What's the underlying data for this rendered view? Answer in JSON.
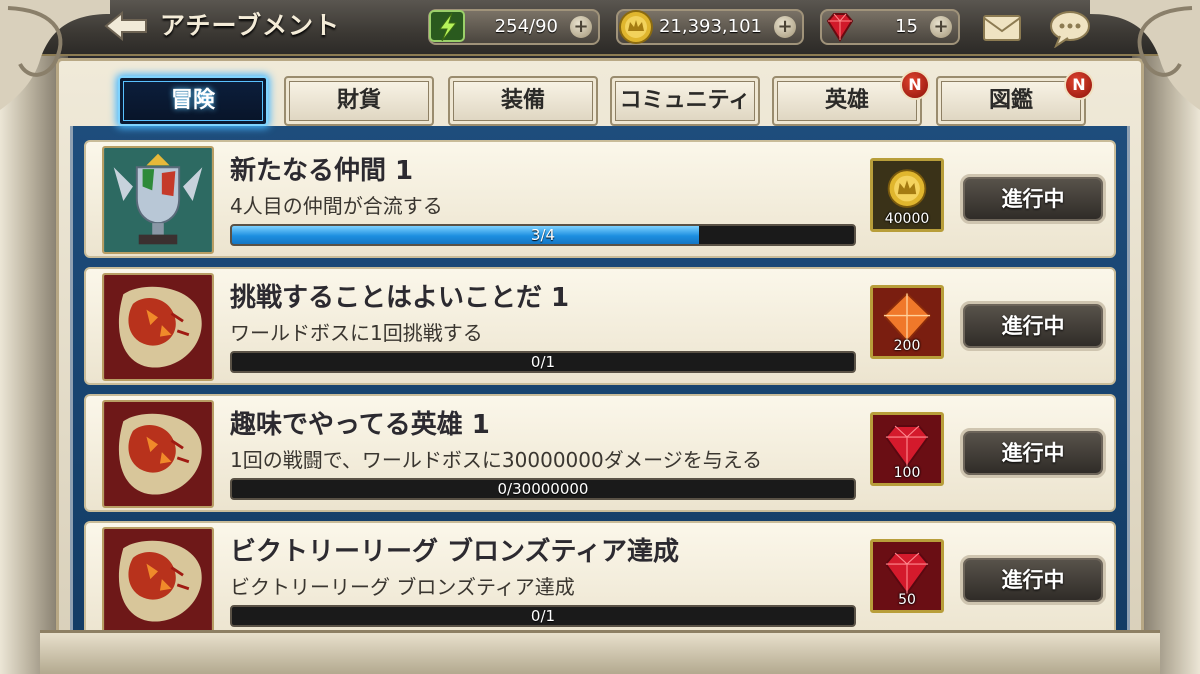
{
  "header": {
    "title": "アチーブメント",
    "stamina": "254/90",
    "gold": "21,393,101",
    "gems": "15",
    "plus": "+"
  },
  "tabs": [
    {
      "label": "冒険",
      "active": true,
      "badge": ""
    },
    {
      "label": "財貨",
      "active": false,
      "badge": ""
    },
    {
      "label": "装備",
      "active": false,
      "badge": ""
    },
    {
      "label": "コミュニティ",
      "active": false,
      "badge": ""
    },
    {
      "label": "英雄",
      "active": false,
      "badge": "N"
    },
    {
      "label": "図鑑",
      "active": false,
      "badge": "N"
    }
  ],
  "achievements": [
    {
      "title": "新たなる仲間 1",
      "description": "4人目の仲間が合流する",
      "progress_text": "3/4",
      "progress": 0.75,
      "reward_type": "gold",
      "reward_amount": "40000",
      "status": "進行中",
      "thumb": "trophy-icon"
    },
    {
      "title": "挑戦することはよいことだ 1",
      "description": "ワールドボスに1回挑戦する",
      "progress_text": "0/1",
      "progress": 0,
      "reward_type": "orange-crystal",
      "reward_amount": "200",
      "status": "進行中",
      "thumb": "world-boss-icon"
    },
    {
      "title": "趣味でやってる英雄 1",
      "description": "1回の戦闘で、ワールドボスに30000000ダメージを与える",
      "progress_text": "0/30000000",
      "progress": 0,
      "reward_type": "ruby",
      "reward_amount": "100",
      "status": "進行中",
      "thumb": "world-boss-icon"
    },
    {
      "title": "ビクトリーリーグ ブロンズティア達成",
      "description": "ビクトリーリーグ ブロンズティア達成",
      "progress_text": "0/1",
      "progress": 0,
      "reward_type": "ruby",
      "reward_amount": "50",
      "status": "進行中",
      "thumb": "world-boss-icon"
    }
  ],
  "colors": {
    "accent": "#49b8ff",
    "progress": "#1d8fe0",
    "badge": "#c3261a"
  }
}
